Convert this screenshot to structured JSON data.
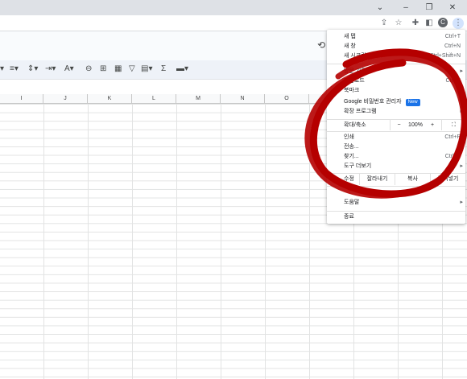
{
  "window": {
    "minimize_glyph": "–",
    "restore_glyph": "❐",
    "close_glyph": "✕",
    "dropdown_glyph": "⌄"
  },
  "browser": {
    "profile_initial": "C"
  },
  "columns": [
    "I",
    "J",
    "K",
    "L",
    "M",
    "N",
    "O"
  ],
  "menu": {
    "new_tab": "새 탭",
    "new_tab_sc": "Ctrl+T",
    "new_window": "새 창",
    "new_window_sc": "Ctrl+N",
    "incognito": "새 시크릿 창",
    "incognito_sc": "Ctrl+Shift+N",
    "history": "방문 기록",
    "downloads": "다운로드",
    "downloads_sc": "Ctrl+J",
    "bookmarks": "북마크",
    "password_manager": "Google 비밀번호 관리자",
    "new_badge": "New",
    "extensions": "확장 프로그램",
    "zoom_label": "확대/축소",
    "zoom_minus": "−",
    "zoom_value": "100%",
    "zoom_plus": "+",
    "print": "인쇄",
    "print_sc": "Ctrl+P",
    "cast": "전송...",
    "find": "찾기...",
    "find_sc": "Ctrl+F",
    "more_tools": "도구 더보기",
    "edit_label": "수정",
    "cut": "잘라내기",
    "copy": "복사",
    "paste": "붙여넣기",
    "help": "도움말",
    "exit": "종료"
  },
  "colors": {
    "annotation_circle": "#b50000",
    "new_badge": "#1a73e8"
  }
}
